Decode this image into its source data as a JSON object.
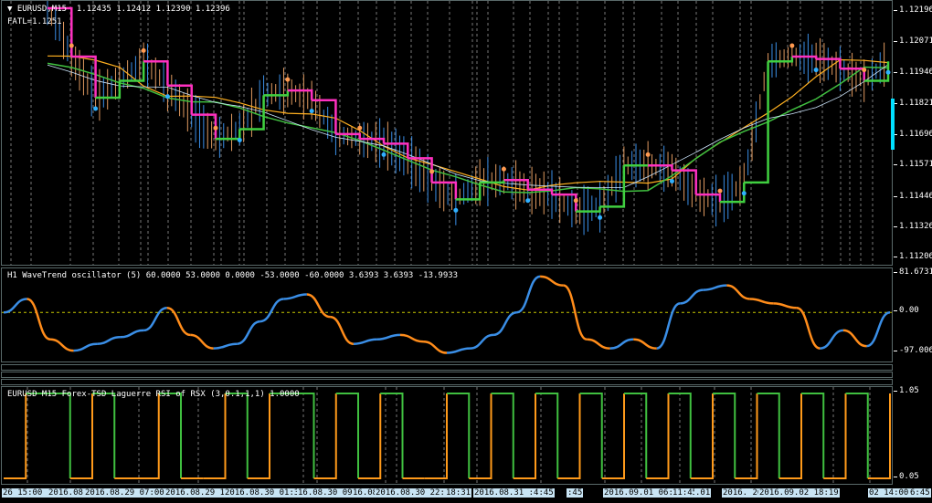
{
  "main_pane": {
    "symbol": "EURUSD,M15",
    "ohlc": "1.12435 1.12412 1.12390 1.12396",
    "fatl_label": "FATL=1.1251",
    "price_labels": [
      "1.12196",
      "1.12071",
      "1.11946",
      "1.11821",
      "1.11696",
      "1.11571",
      "1.11446",
      "1.11326",
      "1.11206"
    ],
    "current_price_color": "#00e0ff"
  },
  "wavetrend_pane": {
    "title": "H1 WaveTrend oscillator (5) 60.0000 53.0000 0.0000 -53.0000 -60.0000 3.6393 3.6393 -13.9933",
    "axis_labels": [
      "81.6731",
      "0.00",
      "-97.0061"
    ],
    "rising_color": "#3a8ee6",
    "falling_color": "#ff8c1a"
  },
  "rsi_pane": {
    "title": "EURUSD M15 Forex-TSD Laguerre RSI of RSX (3,0.1,1,1) 1.0000",
    "axis_labels": [
      "1.05",
      "0.05"
    ],
    "up_color": "#40c040",
    "down_color": "#ff9a1a"
  },
  "time_axis": {
    "labels": [
      "26 15:00 7:",
      "2016.08.",
      "2016.08.29 07:00",
      "2016.08.29 1",
      "2016.08.30 01:30",
      "16.08.30 09:45",
      "16.08.",
      "2016.08.30 22:45",
      "18:31",
      "2016.08.31 :4:45",
      ":45",
      "2016.09.01 06:45",
      "11:45",
      ".01",
      "2016. 201",
      "2016.09.02 18:19",
      "02 14:00",
      "6:45"
    ]
  },
  "chart_data": [
    {
      "type": "line",
      "title": "EURUSD,M15",
      "ylim": [
        1.1116,
        1.1225
      ],
      "series": [
        {
          "name": "FATL",
          "values": [
            1.1222,
            1.1202,
            1.1185,
            1.1192,
            1.12,
            1.119,
            1.1178,
            1.1168,
            1.1172,
            1.1186,
            1.1188,
            1.1184,
            1.117,
            1.1168,
            1.1166,
            1.116,
            1.115,
            1.1143,
            1.115,
            1.1151,
            1.1147,
            1.1145,
            1.1138,
            1.114,
            1.1157,
            1.1157,
            1.1155,
            1.1145,
            1.1142,
            1.115,
            1.12,
            1.1202,
            1.1201,
            1.1197,
            1.1192,
            1.12
          ]
        }
      ]
    },
    {
      "type": "line",
      "title": "H1 WaveTrend oscillator (5)",
      "ylim": [
        -97.0061,
        81.6731
      ],
      "series": [
        {
          "name": "WaveTrend",
          "values": [
            0,
            30,
            -60,
            -85,
            -70,
            -55,
            -40,
            10,
            -50,
            -80,
            -70,
            -20,
            30,
            40,
            -10,
            -70,
            -60,
            -50,
            -65,
            -90,
            -80,
            -50,
            0,
            80,
            60,
            -60,
            -80,
            -60,
            -80,
            20,
            50,
            60,
            30,
            20,
            10,
            -80,
            -40,
            -75,
            0
          ]
        }
      ]
    },
    {
      "type": "line",
      "title": "Laguerre RSI of RSX",
      "ylim": [
        0.05,
        1.05
      ],
      "series": [
        {
          "name": "RSI",
          "values": [
            0,
            1,
            1,
            0,
            1,
            0,
            0,
            1,
            0,
            0,
            1,
            0,
            1,
            1,
            0,
            1,
            0,
            1,
            0,
            0,
            1,
            0,
            1,
            0,
            1,
            0,
            1,
            0,
            1,
            0,
            1,
            0,
            1,
            0,
            1,
            0,
            1,
            0,
            1,
            0,
            1
          ]
        }
      ]
    }
  ]
}
